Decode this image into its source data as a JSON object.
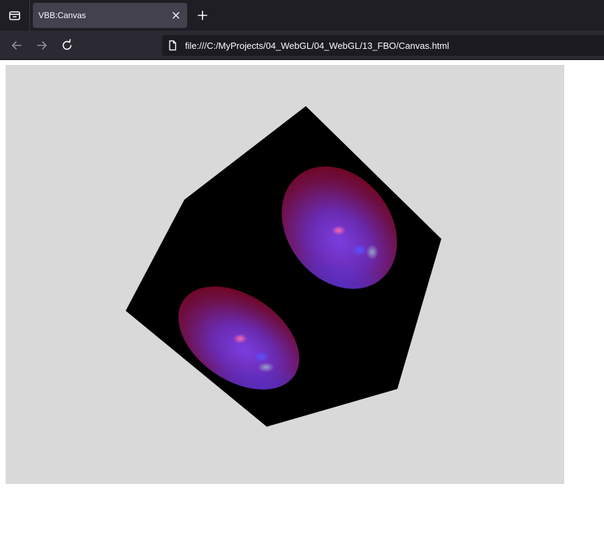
{
  "tab": {
    "title": "VBB:Canvas",
    "active": true
  },
  "toolbar": {
    "buttons": [
      {
        "icon": "back-arrow-icon",
        "enabled": false
      },
      {
        "icon": "forward-arrow-icon",
        "enabled": false
      },
      {
        "icon": "reload-icon",
        "enabled": true
      }
    ]
  },
  "address_bar": {
    "url": "file:///C:/MyProjects/04_WebGL/04_WebGL/13_FBO/Canvas.html",
    "icon": "page-icon"
  },
  "canvas": {
    "background": "#d9d9d9",
    "scene": {
      "object": "cube",
      "face_color": "#000000",
      "texture": "two glossy ellipsoids",
      "ellipsoid_colors": [
        "#8a0010",
        "#6a30c8",
        "#4a3cf0"
      ]
    }
  },
  "colors": {
    "tabstrip": "#1f1e25",
    "active_tab": "#42414d",
    "toolbar": "#2b2a33",
    "urlbar": "#1c1b22",
    "text": "#fbfbfe"
  }
}
